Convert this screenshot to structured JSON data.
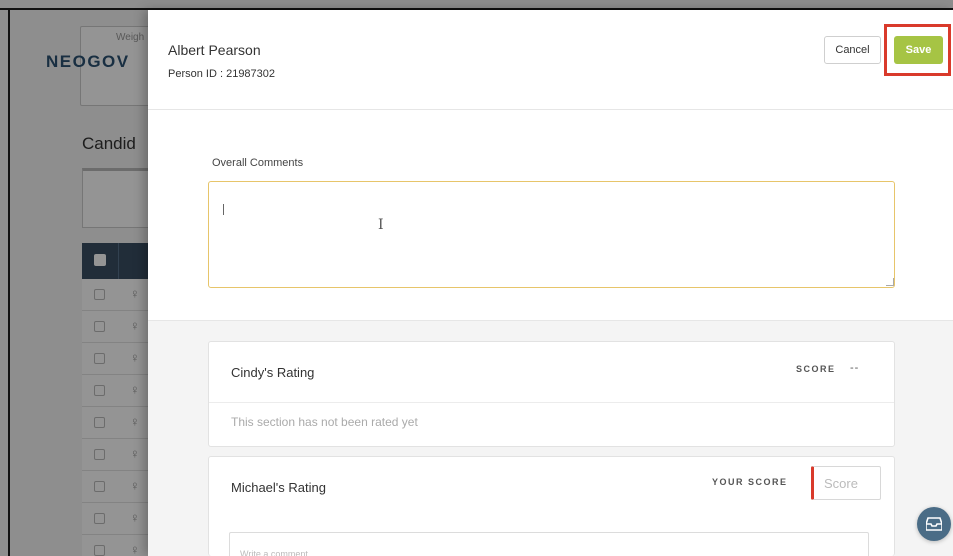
{
  "background": {
    "logo": "NEOGOV",
    "weight_label": "Weigh",
    "candidates_heading": "Candid",
    "row_count": 9
  },
  "panel": {
    "person_name": "Albert Pearson",
    "person_id": "Person ID : 21987302",
    "cancel_label": "Cancel",
    "save_label": "Save",
    "comments": {
      "label": "Overall Comments",
      "value": ""
    },
    "ratings": [
      {
        "title": "Cindy's Rating",
        "score_label": "SCORE",
        "score_value": "--",
        "status": "This section has not been rated yet"
      },
      {
        "title": "Michael's Rating",
        "score_label": "YOUR SCORE",
        "score_placeholder": "Score",
        "comment_placeholder": "Write a comment"
      }
    ]
  },
  "colors": {
    "save_green": "#a6c444",
    "highlight_red": "#d93a2b",
    "input_focus_border": "#e7c56a"
  },
  "icons": {
    "fab": "inbox-icon",
    "row": "person-icon"
  }
}
